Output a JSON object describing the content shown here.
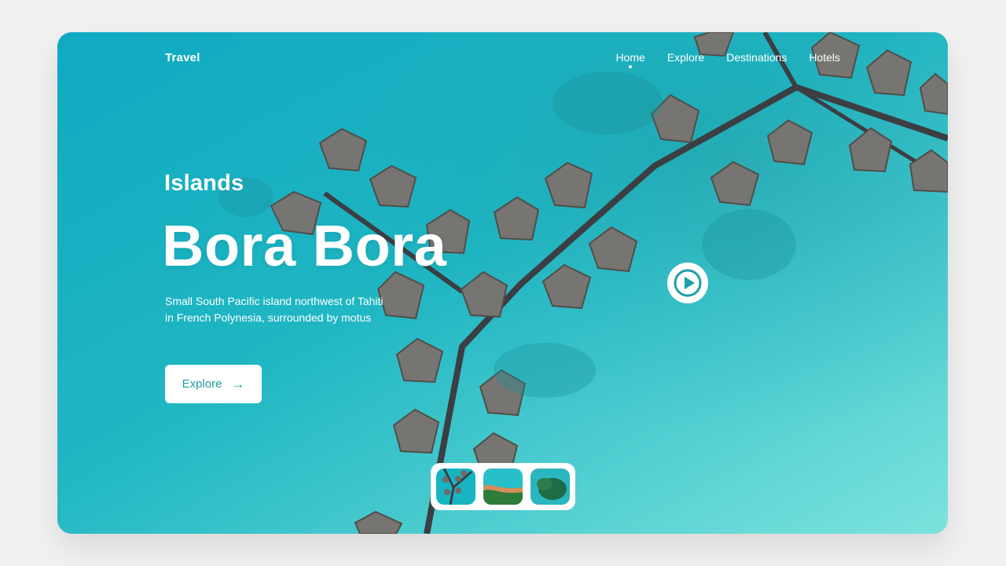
{
  "brand": "Travel",
  "nav": [
    {
      "label": "Home",
      "active": true
    },
    {
      "label": "Explore",
      "active": false
    },
    {
      "label": "Destinations",
      "active": false
    },
    {
      "label": "Hotels",
      "active": false
    }
  ],
  "hero": {
    "kicker": "Islands",
    "title": "Bora Bora",
    "description": "Small South Pacific island northwest of Tahiti in French Polynesia, surrounded by motus",
    "cta_label": "Explore",
    "cta_icon": "arrow-right-icon"
  },
  "video": {
    "icon": "play-icon"
  },
  "gallery": {
    "thumbnails": [
      "overwater-villas",
      "beach-island",
      "forest-island"
    ]
  },
  "colors": {
    "accent": "#1f9ea5",
    "water": "#26b8c6",
    "white": "#ffffff"
  }
}
